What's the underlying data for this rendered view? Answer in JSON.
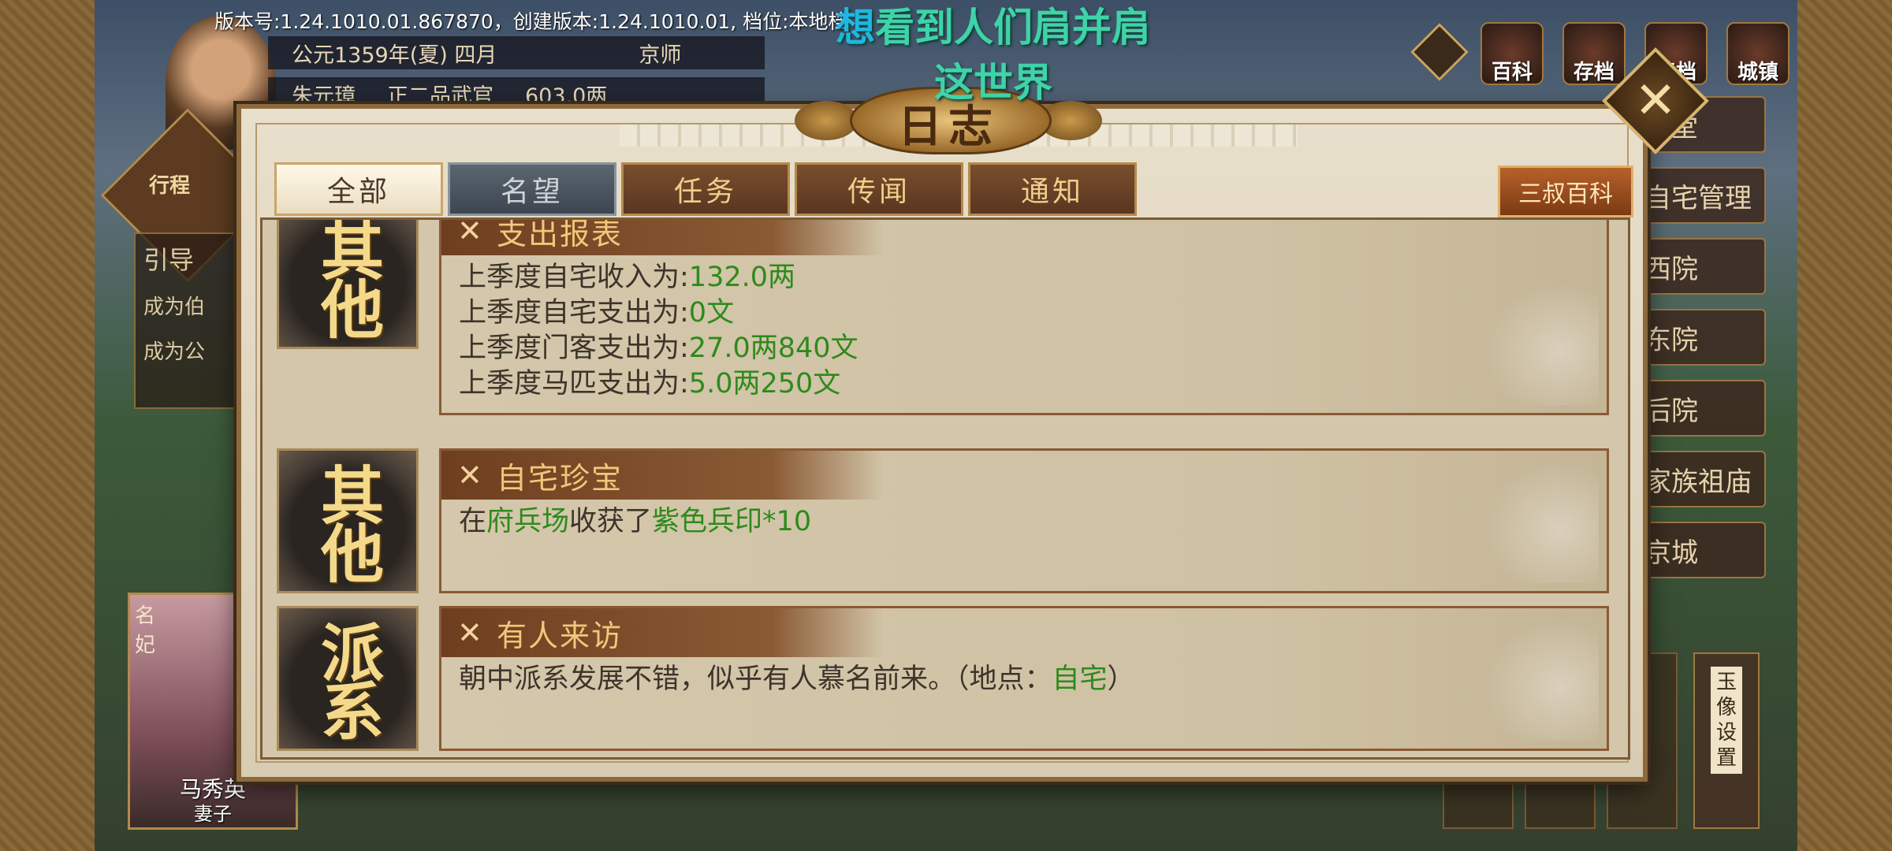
{
  "version_text": "版本号:1.24.1010.01.867870，创建版本:1.24.1010.01, 档位:本地档",
  "marquee": {
    "highlight": "想",
    "line1_rest": "看到人们肩并肩",
    "line2": "这世界"
  },
  "status": {
    "date": "公元1359年(夏) 四月",
    "location": "京师",
    "name": "朱元璋",
    "rank": "正二品武官",
    "money": "603.0两"
  },
  "left_menu": {
    "label": "行程"
  },
  "guide": {
    "title": "引导",
    "items": [
      "成为伯",
      "成为公"
    ]
  },
  "mistress": {
    "tag": "名妃",
    "name": "马秀英",
    "role": "妻子"
  },
  "top_icons": [
    "百科",
    "存档",
    "读档",
    "城镇"
  ],
  "right_menu": [
    "正堂",
    "自宅管理",
    "西院",
    "东院",
    "后院",
    "家族祖庙",
    "京城"
  ],
  "bottom_right": {
    "avatar_settings": "玉像设置"
  },
  "dialog": {
    "title": "日志",
    "close_glyph": "✕",
    "tabs": [
      {
        "label": "全部",
        "state": "active"
      },
      {
        "label": "名望",
        "state": "dim"
      },
      {
        "label": "任务",
        "state": "normal"
      },
      {
        "label": "传闻",
        "state": "normal"
      },
      {
        "label": "通知",
        "state": "normal"
      }
    ],
    "wiki_button": "三叔百科",
    "entries": [
      {
        "badge": "其他",
        "title": "支出报表",
        "lines": [
          {
            "prefix": "上季度自宅收入为:",
            "value": "132.0两"
          },
          {
            "prefix": "上季度自宅支出为:",
            "value": "0文"
          },
          {
            "prefix": "上季度门客支出为:",
            "value": "27.0两840文"
          },
          {
            "prefix": "上季度马匹支出为:",
            "value": "5.0两250文"
          }
        ]
      },
      {
        "badge": "其他",
        "title": "自宅珍宝",
        "parts": [
          "在",
          "府兵场",
          "收获了",
          "紫色兵印*10"
        ]
      },
      {
        "badge": "派系",
        "title": "有人来访",
        "parts": [
          "朝中派系发展不错，似乎有人慕名前来。（地点：",
          "自宅",
          "）"
        ]
      }
    ]
  },
  "colors": {
    "green_value": "#2e8a1c",
    "tab_text": "#f0cf8a",
    "marquee": "#3ed3a8"
  }
}
